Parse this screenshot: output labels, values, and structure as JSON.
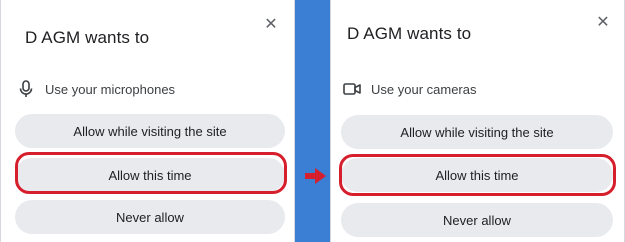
{
  "left_dialog": {
    "title": "D AGM wants to",
    "close_glyph": "✕",
    "permission": {
      "icon": "microphone-icon",
      "label": "Use your microphones"
    },
    "buttons": {
      "allow_visiting": "Allow while visiting the site",
      "allow_once": "Allow this time",
      "never": "Never allow"
    }
  },
  "right_dialog": {
    "title": "D AGM wants to",
    "close_glyph": "✕",
    "permission": {
      "icon": "camera-icon",
      "label": "Use your cameras"
    },
    "buttons": {
      "allow_visiting": "Allow while visiting the site",
      "allow_once": "Allow this time",
      "never": "Never allow"
    }
  },
  "colors": {
    "highlight": "#d61f2c",
    "button_bg": "#e8eaed",
    "background": "#3a7fd3"
  }
}
